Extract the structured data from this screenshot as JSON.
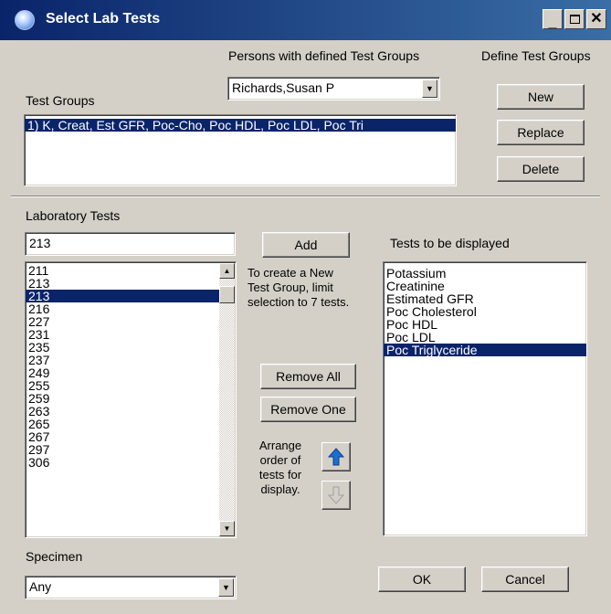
{
  "window": {
    "title": "Select Lab Tests"
  },
  "groups_panel": {
    "persons_label": "Persons with defined Test Groups",
    "define_label": "Define Test Groups",
    "person_selected": "Richards,Susan P",
    "test_groups_label": "Test Groups",
    "test_groups": [
      {
        "label": "1) K, Creat, Est GFR, Poc-Cho, Poc HDL, Poc LDL, Poc Tri",
        "selected": true
      }
    ],
    "new_button": "New",
    "replace_button": "Replace",
    "delete_button": "Delete"
  },
  "lab_panel": {
    "lab_tests_label": "Laboratory Tests",
    "search_value": "213",
    "add_button": "Add",
    "hint": [
      "To create a New",
      "Test Group, limit",
      "selection to 7 tests."
    ],
    "lab_list": [
      {
        "label": "211",
        "selected": false
      },
      {
        "label": "213",
        "selected": false
      },
      {
        "label": "213",
        "selected": true
      },
      {
        "label": "216",
        "selected": false
      },
      {
        "label": "227",
        "selected": false
      },
      {
        "label": "231",
        "selected": false
      },
      {
        "label": "235",
        "selected": false
      },
      {
        "label": "237",
        "selected": false
      },
      {
        "label": "249",
        "selected": false
      },
      {
        "label": "255",
        "selected": false
      },
      {
        "label": "259",
        "selected": false
      },
      {
        "label": "263",
        "selected": false
      },
      {
        "label": "265",
        "selected": false
      },
      {
        "label": "267",
        "selected": false
      },
      {
        "label": "297",
        "selected": false
      },
      {
        "label": "306",
        "selected": false
      }
    ],
    "remove_all_button": "Remove All",
    "remove_one_button": "Remove One",
    "arrange_text": [
      "Arrange",
      "order of",
      "tests for",
      "display."
    ],
    "displayed_label": "Tests to be displayed",
    "displayed_list": [
      {
        "label": "Potassium",
        "selected": false
      },
      {
        "label": "Creatinine",
        "selected": false
      },
      {
        "label": "Estimated GFR",
        "selected": false
      },
      {
        "label": "Poc Cholesterol",
        "selected": false
      },
      {
        "label": "Poc HDL",
        "selected": false
      },
      {
        "label": "Poc LDL",
        "selected": false
      },
      {
        "label": "Poc Triglyceride",
        "selected": true
      }
    ],
    "specimen_label": "Specimen",
    "specimen_value": "Any",
    "ok_button": "OK",
    "cancel_button": "Cancel"
  },
  "colors": {
    "selection": "#0a246a",
    "move_up_arrow": "#1a6fd0",
    "move_down_arrow": "#a0a0a0"
  }
}
